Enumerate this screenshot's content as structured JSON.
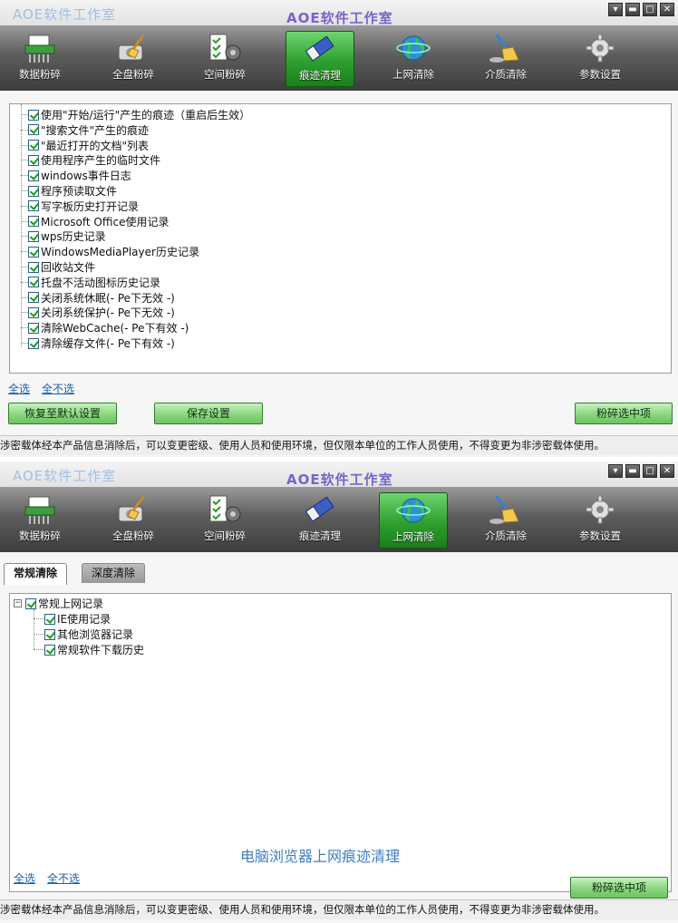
{
  "app": {
    "left_title": "AOE软件工作室",
    "center_title": "AOE软件工作室",
    "window_buttons": [
      "▾",
      "▬",
      "□",
      "✕"
    ]
  },
  "toolbar": [
    {
      "label": "数据粉碎",
      "icon": "shredder-icon"
    },
    {
      "label": "全盘粉碎",
      "icon": "disk-broom-icon"
    },
    {
      "label": "空间粉碎",
      "icon": "checklist-gear-icon"
    },
    {
      "label": "痕迹清理",
      "icon": "eraser-icon"
    },
    {
      "label": "上网清除",
      "icon": "globe-icon"
    },
    {
      "label": "介质清除",
      "icon": "broom-icon"
    },
    {
      "label": "参数设置",
      "icon": "gear-icon"
    }
  ],
  "window1": {
    "active_tool": "痕迹清理",
    "items": [
      "使用\"开始/运行\"产生的痕迹（重启后生效）",
      "\"搜索文件\"产生的痕迹",
      "\"最近打开的文档\"列表",
      "使用程序产生的临时文件",
      "windows事件日志",
      "程序预读取文件",
      "写字板历史打开记录",
      "Microsoft Office使用记录",
      "wps历史记录",
      "WindowsMediaPlayer历史记录",
      "回收站文件",
      "托盘不活动图标历史记录",
      "关闭系统休眠(- Pe下无效 -)",
      "关闭系统保护(- Pe下无效 -)",
      "清除WebCache(- Pe下有效 -)",
      "清除缓存文件(- Pe下有效 -)"
    ],
    "select_all": "全选",
    "select_none": "全不选",
    "restore_default": "恢复至默认设置",
    "save_settings": "保存设置",
    "shred_selected": "粉碎选中项",
    "status": "涉密载体经本产品信息消除后，可以变更密级、使用人员和使用环境，但仅限本单位的工作人员使用，不得变更为非涉密载体使用。"
  },
  "window2": {
    "active_tool": "上网清除",
    "tabs": [
      "常规清除",
      "深度清除"
    ],
    "tree_root": "常规上网记录",
    "tree_children": [
      "IE使用记录",
      "其他浏览器记录",
      "常规软件下载历史"
    ],
    "expander": "−",
    "watermark": "电脑浏览器上网痕迹清理",
    "select_all": "全选",
    "select_none": "全不选",
    "shred_selected": "粉碎选中项",
    "status": "涉密载体经本产品信息消除后，可以变更密级、使用人员和使用环境，但仅限本单位的工作人员使用，不得变更为非涉密载体使用。"
  }
}
